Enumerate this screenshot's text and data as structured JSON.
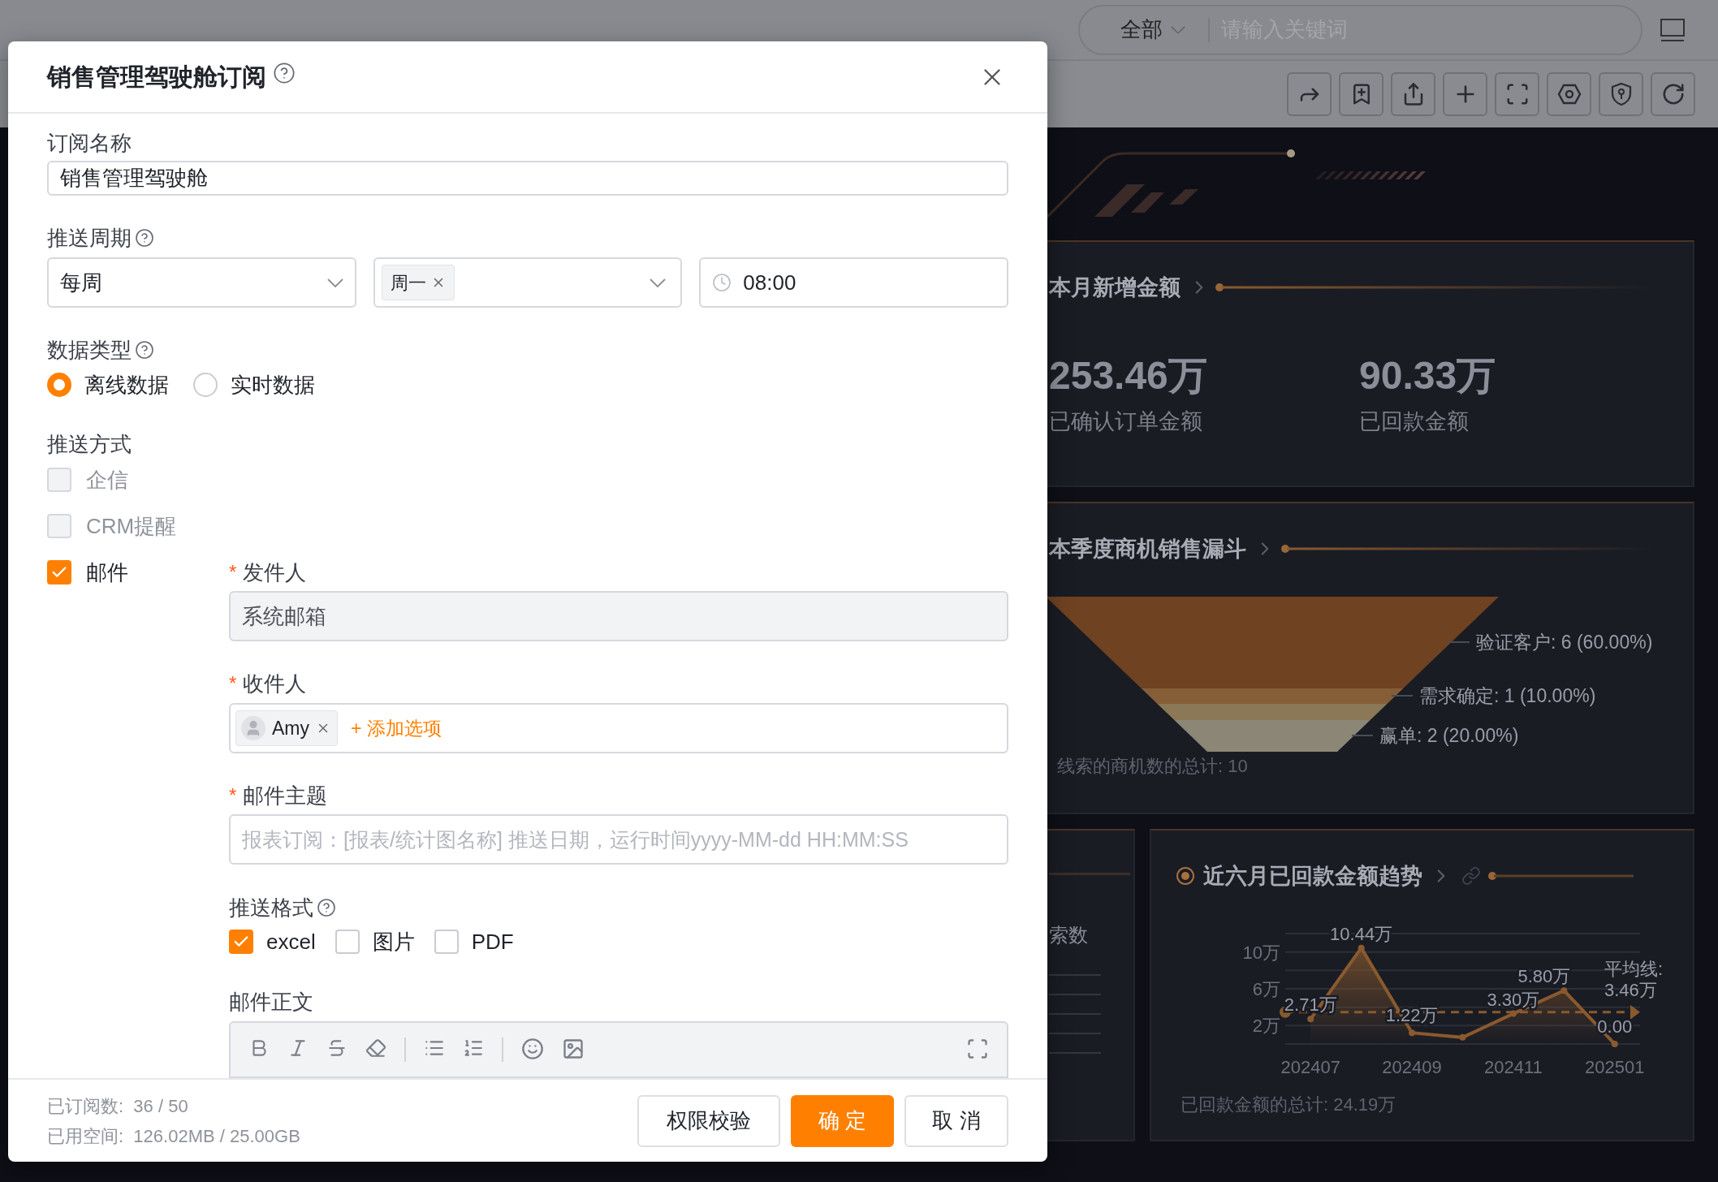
{
  "header": {
    "scope": "全部",
    "search_placeholder": "请输入关键词"
  },
  "kpi_card": {
    "title": "本月新增金额",
    "metrics": [
      {
        "value": "253.46万",
        "label": "已确认订单金额"
      },
      {
        "value": "90.33万",
        "label": "已回款金额"
      }
    ]
  },
  "funnel_card": {
    "title": "本季度商机销售漏斗",
    "stages": [
      {
        "color": "#6f4221",
        "label": "验证客户: 6 (60.00%)"
      },
      {
        "color": "#855e38",
        "label": "需求确定: 1 (10.00%)"
      },
      {
        "color": "#8a7856"
      },
      {
        "color": "#8c8677",
        "label": "赢单: 2 (20.00%)"
      }
    ],
    "footer": "线索的商机数的总计: 10"
  },
  "side_card": {
    "label": "索数"
  },
  "trend_card": {
    "title": "近六月已回款金额趋势",
    "footer": "已回款金额的总计: 24.19万",
    "chart_data": {
      "type": "line",
      "categories": [
        "202407",
        null,
        "202409",
        null,
        "202411",
        null,
        "202501"
      ],
      "ylim": [
        0,
        12
      ],
      "yticks": [
        {
          "value": 2,
          "label": "2万"
        },
        {
          "value": 6,
          "label": "6万"
        },
        {
          "value": 10,
          "label": "10万"
        }
      ],
      "grid": true,
      "series": [
        {
          "color": "#8a5a2e",
          "marker": "circle",
          "values": [
            2.71,
            10.44,
            1.22,
            0.72,
            3.3,
            5.8,
            0
          ]
        }
      ],
      "value_labels": [
        "2.71万",
        "10.44万",
        "1.22万",
        null,
        "3.30万",
        "5.80万",
        "0.00"
      ],
      "ref_lines": [
        {
          "axis": "y",
          "value": 3.46,
          "color": "#8a5a2e",
          "label": "平均线: 3.46万"
        }
      ]
    }
  },
  "dialog": {
    "title": "销售管理驾驶舱订阅",
    "name": {
      "label": "订阅名称",
      "value": "销售管理驾驶舱"
    },
    "schedule": {
      "label": "推送周期",
      "help": true,
      "frequency": "每周",
      "days": [
        "周一"
      ],
      "time": "08:00"
    },
    "data_type": {
      "label": "数据类型",
      "help": true,
      "options": [
        {
          "label": "离线数据",
          "selected": true
        },
        {
          "label": "实时数据",
          "selected": false
        }
      ]
    },
    "push": {
      "label": "推送方式",
      "methods": [
        {
          "label": "企信",
          "kind": "plain",
          "checked": false,
          "disabled": true
        },
        {
          "label": "CRM提醒",
          "kind": "plain",
          "checked": false,
          "disabled": true
        },
        {
          "label": "邮件",
          "kind": "email",
          "checked": true,
          "disabled": false
        }
      ]
    },
    "email": {
      "sender": {
        "mark": "*",
        "label": "发件人",
        "value": "系统邮箱"
      },
      "recipients": {
        "mark": "*",
        "label": "收件人",
        "tags": [
          "Amy"
        ],
        "add_label": "+ 添加选项"
      },
      "subject": {
        "mark": "*",
        "label": "邮件主题",
        "placeholder": "报表订阅：[报表/统计图名称] 推送日期，运行时间yyyy-MM-dd HH:MM:SS"
      },
      "formats": {
        "label": "推送格式",
        "help": true,
        "options": [
          {
            "label": "excel",
            "checked": true
          },
          {
            "label": "图片",
            "checked": false
          },
          {
            "label": "PDF",
            "checked": false
          }
        ]
      },
      "body": {
        "label": "邮件正文"
      }
    },
    "footer": {
      "stats": [
        "已订阅数:  36 / 50",
        "已用空间:  126.02MB / 25.00GB"
      ],
      "buttons": [
        {
          "label": "权限校验",
          "kind": "default"
        },
        {
          "label": "确 定",
          "kind": "primary"
        },
        {
          "label": "取 消",
          "kind": "default"
        }
      ]
    }
  }
}
